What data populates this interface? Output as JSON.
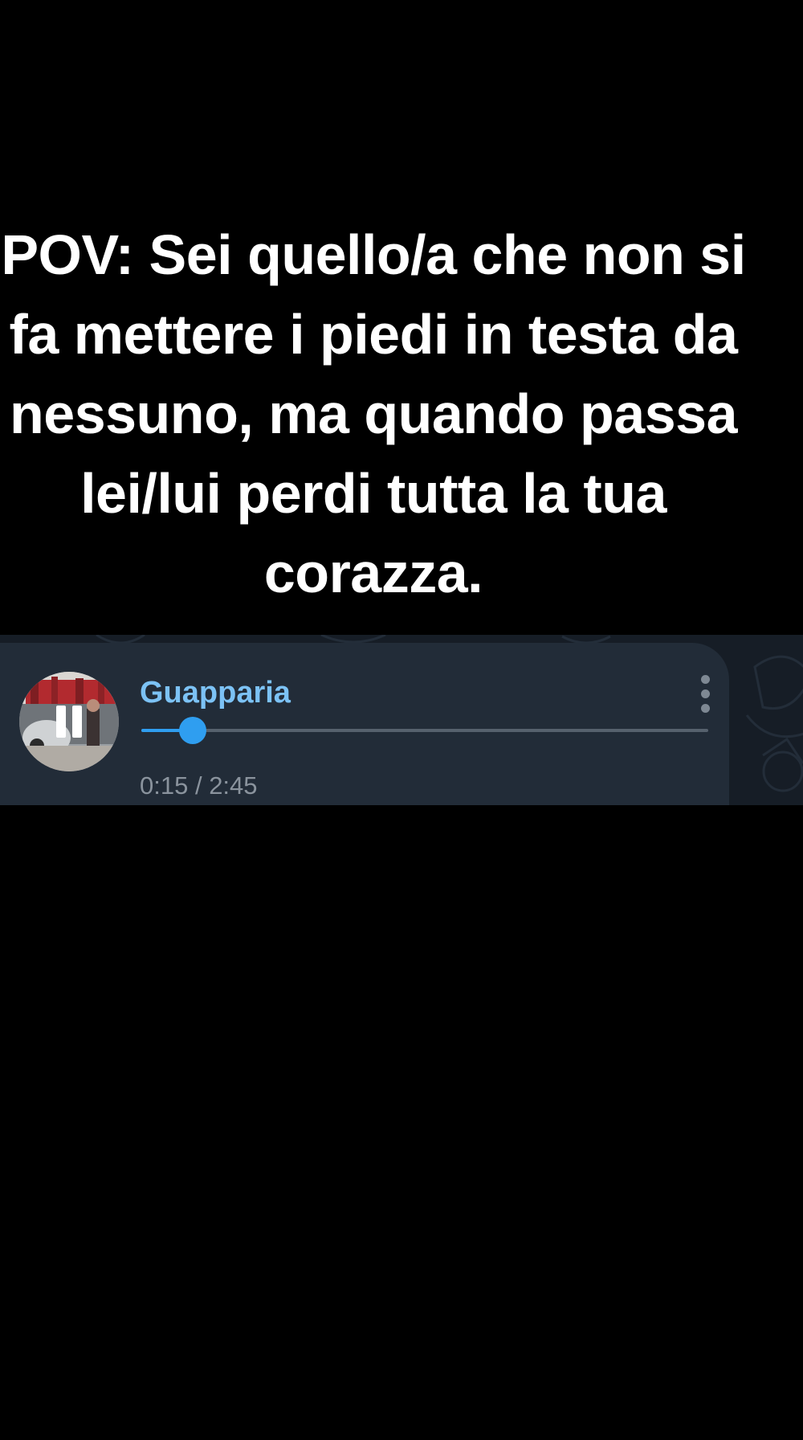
{
  "caption": {
    "lines": [
      "POV: Sei quello/a che non si",
      "fa mettere i piedi in testa da",
      "nessuno, ma quando passa",
      "lei/lui perdi tutta la tua",
      "corazza."
    ]
  },
  "player": {
    "title": "Guapparia",
    "elapsed": "0:15",
    "separator": " / ",
    "duration": "2:45",
    "progress_fraction": 0.091,
    "state": "playing",
    "play_pause_icon": "pause-icon",
    "menu_icon": "more-vertical-icon",
    "colors": {
      "accent": "#2f9ef0",
      "title": "#7cc2f5",
      "bubble": "#222c38",
      "background": "#161d26",
      "time_text": "#8a939d"
    }
  }
}
